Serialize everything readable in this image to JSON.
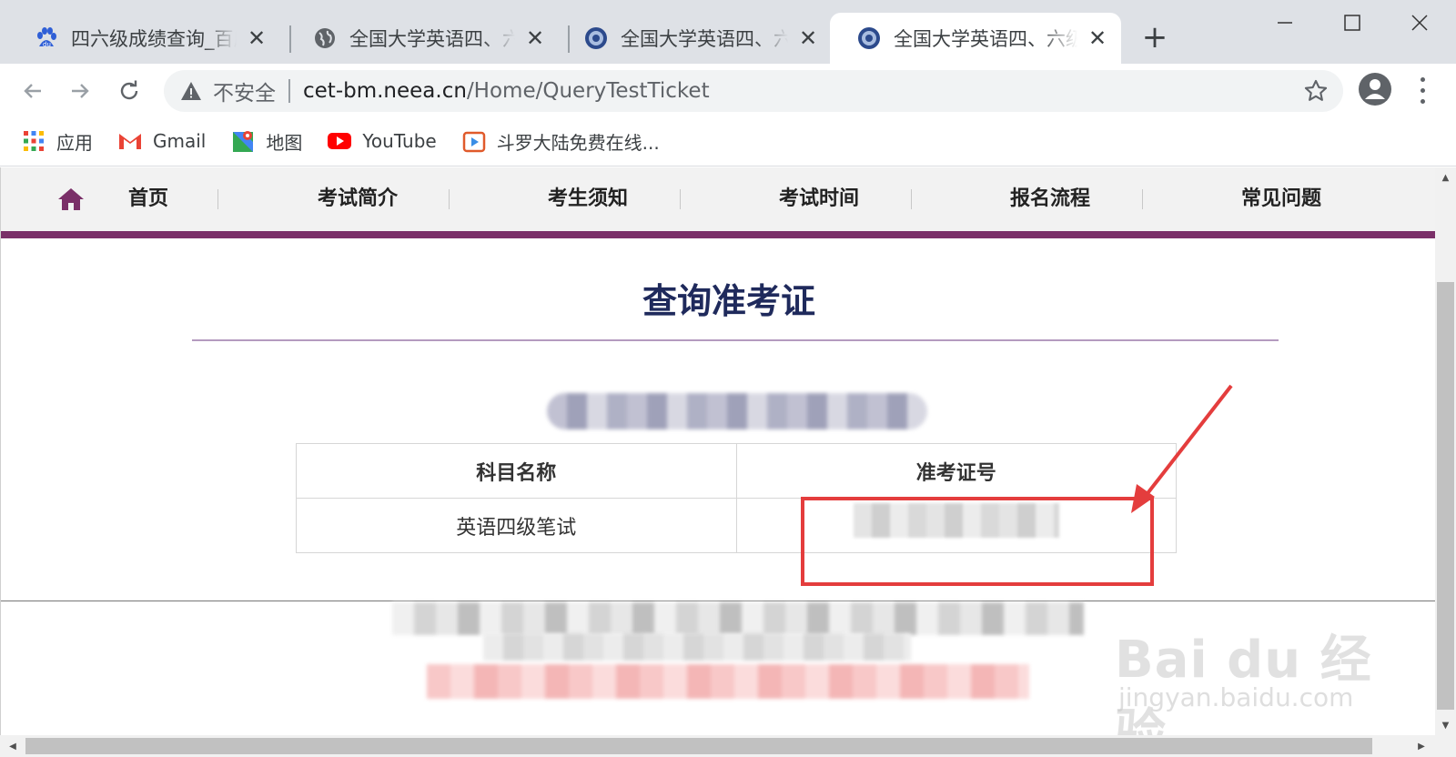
{
  "browser": {
    "tabs": [
      {
        "title": "四六级成绩查询_百度搜",
        "favicon": "baidu-paw-icon"
      },
      {
        "title": "全国大学英语四、六级",
        "favicon": "globe-icon"
      },
      {
        "title": "全国大学英语四、六级",
        "favicon": "neea-seal-icon"
      },
      {
        "title": "全国大学英语四、六级",
        "favicon": "neea-seal-icon"
      }
    ],
    "new_tab_label": "+",
    "close_glyph": "✕",
    "security_label": "不安全",
    "url_host": "cet-bm.neea.cn",
    "url_path": "/Home/QueryTestTicket"
  },
  "bookmarks": [
    {
      "label": "应用",
      "icon": "apps-grid-icon"
    },
    {
      "label": "Gmail",
      "icon": "gmail-icon"
    },
    {
      "label": "地图",
      "icon": "maps-icon"
    },
    {
      "label": "YouTube",
      "icon": "youtube-icon"
    },
    {
      "label": "斗罗大陆免费在线...",
      "icon": "video-play-icon"
    }
  ],
  "site_nav": {
    "items": [
      "首页",
      "考试简介",
      "考生须知",
      "考试时间",
      "报名流程",
      "常见问题"
    ],
    "accent_color": "#7a2f68"
  },
  "main": {
    "title": "查询准考证",
    "table": {
      "headers": [
        "科目名称",
        "准考证号"
      ],
      "rows": [
        {
          "subject": "英语四级笔试"
        }
      ]
    }
  },
  "watermark": {
    "logo_text": "Bai du 经验",
    "url": "jingyan.baidu.com"
  },
  "colors": {
    "title": "#1f2a5c",
    "highlight_box": "#e43d3d"
  }
}
